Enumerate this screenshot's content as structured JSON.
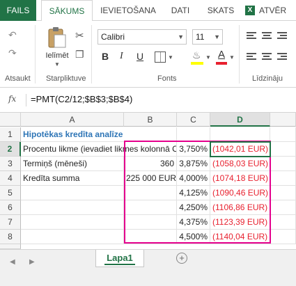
{
  "ribbon": {
    "tabs": [
      "FAILS",
      "SĀKUMS",
      "IEVIETOŠANA",
      "DATI",
      "SKATS",
      "ATVĒR"
    ],
    "excel_icon": "X",
    "groups": {
      "undo": "Atsaukt",
      "clipboard": "Starpliktuve",
      "fonts": "Fonts",
      "align": "Līdzināju"
    },
    "paste_label": "Ielīmēt",
    "font_name": "Calibri",
    "font_size": "11",
    "bold": "B",
    "italic": "I",
    "underline": "U",
    "font_color_letter": "A"
  },
  "formula_bar": {
    "fx": "fx",
    "formula": "=PMT(C2/12;$B$3;$B$4)"
  },
  "grid": {
    "columns": [
      "A",
      "B",
      "C",
      "D"
    ],
    "rows": [
      "1",
      "2",
      "3",
      "4",
      "5",
      "6",
      "7",
      "8"
    ],
    "title": "Hipotēkas kredīta analīze",
    "a2": "Procentu likme (ievadiet likmes kolonnā C)",
    "a3": "Termiņš (mēneši)",
    "a4": "Kredīta summa",
    "b3": "360",
    "b4": "225 000 EUR",
    "rates": [
      "3,750%",
      "3,875%",
      "4,000%",
      "4,125%",
      "4,250%",
      "4,375%",
      "4,500%"
    ],
    "payments": [
      "(1042,01 EUR)",
      "(1058,03 EUR)",
      "(1074,18 EUR)",
      "(1090,46 EUR)",
      "(1106,86 EUR)",
      "(1123,39 EUR)",
      "(1140,04 EUR)"
    ]
  },
  "sheets": {
    "active": "Lapa1",
    "add": "+"
  },
  "colors": {
    "accent": "#217346",
    "highlight_box": "#e4008d",
    "negative": "#e8212f",
    "title": "#2e75b6"
  }
}
